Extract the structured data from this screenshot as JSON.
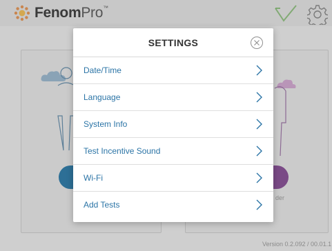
{
  "app": {
    "logo_bold": "Fenom",
    "logo_light": "Pro",
    "logo_tm": "™",
    "bg_label": "der",
    "version": "Version 0.2.092 / 00.01.1"
  },
  "settings": {
    "title": "SETTINGS",
    "items": [
      {
        "label": "Date/Time"
      },
      {
        "label": "Language"
      },
      {
        "label": "System Info"
      },
      {
        "label": "Test Incentive Sound"
      },
      {
        "label": "Wi-Fi"
      },
      {
        "label": "Add Tests"
      }
    ]
  },
  "colors": {
    "accent": "#2b74a6",
    "overlay": "#c9c9c9",
    "pill_blue": "#2d6f96",
    "pill_purple": "#7a4a86",
    "check_green": "#7ab56a"
  },
  "icons": {
    "logo": "sun-logo-icon",
    "top_right": [
      "checkmark-icon",
      "gear-icon"
    ],
    "close": "close-circle-icon",
    "row": "chevron-right-icon"
  }
}
